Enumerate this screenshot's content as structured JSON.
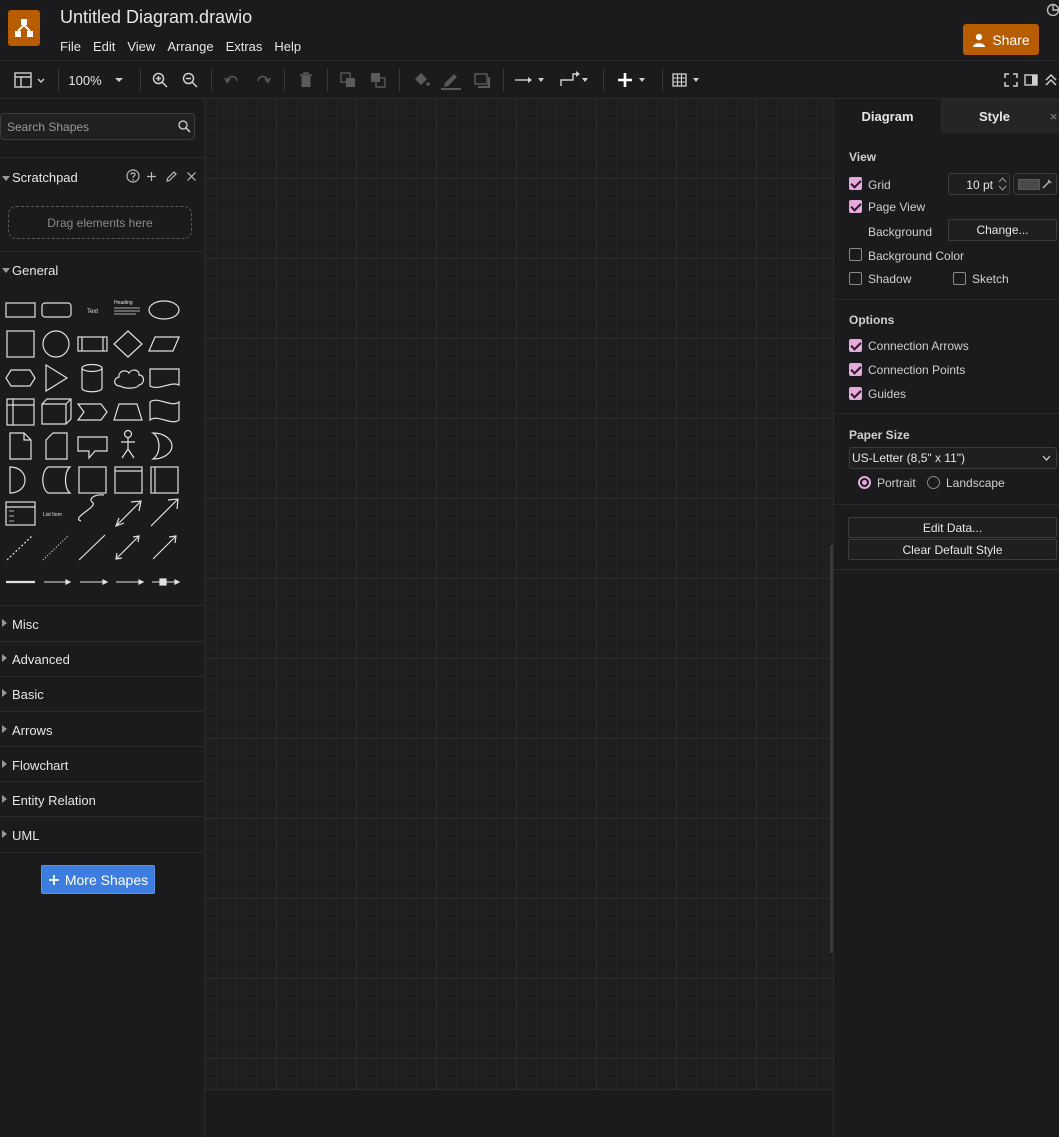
{
  "app": {
    "title": "Untitled Diagram.drawio",
    "share_label": "Share"
  },
  "menu": [
    "File",
    "Edit",
    "View",
    "Arrange",
    "Extras",
    "Help"
  ],
  "toolbar": {
    "zoom": "100%"
  },
  "sidebar": {
    "search_placeholder": "Search Shapes",
    "scratchpad_title": "Scratchpad",
    "scratchpad_drop": "Drag elements here",
    "general_title": "General",
    "sections": [
      "Misc",
      "Advanced",
      "Basic",
      "Arrows",
      "Flowchart",
      "Entity Relation",
      "UML"
    ],
    "more_shapes": "More Shapes"
  },
  "panel": {
    "tabs": {
      "diagram": "Diagram",
      "style": "Style"
    },
    "view": {
      "heading": "View",
      "grid": {
        "label": "Grid",
        "checked": true,
        "size": "10 pt"
      },
      "page_view": {
        "label": "Page View",
        "checked": true
      },
      "background_label": "Background",
      "change_button": "Change...",
      "background_color": {
        "label": "Background Color",
        "checked": false
      },
      "shadow": {
        "label": "Shadow",
        "checked": false
      },
      "sketch": {
        "label": "Sketch",
        "checked": false
      }
    },
    "options": {
      "heading": "Options",
      "connection_arrows": {
        "label": "Connection Arrows",
        "checked": true
      },
      "connection_points": {
        "label": "Connection Points",
        "checked": true
      },
      "guides": {
        "label": "Guides",
        "checked": true
      }
    },
    "paper": {
      "heading": "Paper Size",
      "selected": "US-Letter (8,5\" x 11\")",
      "portrait": {
        "label": "Portrait",
        "selected": true
      },
      "landscape": {
        "label": "Landscape",
        "selected": false
      }
    },
    "edit_data": "Edit Data...",
    "clear_default_style": "Clear Default Style"
  },
  "colors": {
    "accent": "#b85c00",
    "check": "#e6a9dc",
    "more_shapes": "#3d7de0"
  }
}
